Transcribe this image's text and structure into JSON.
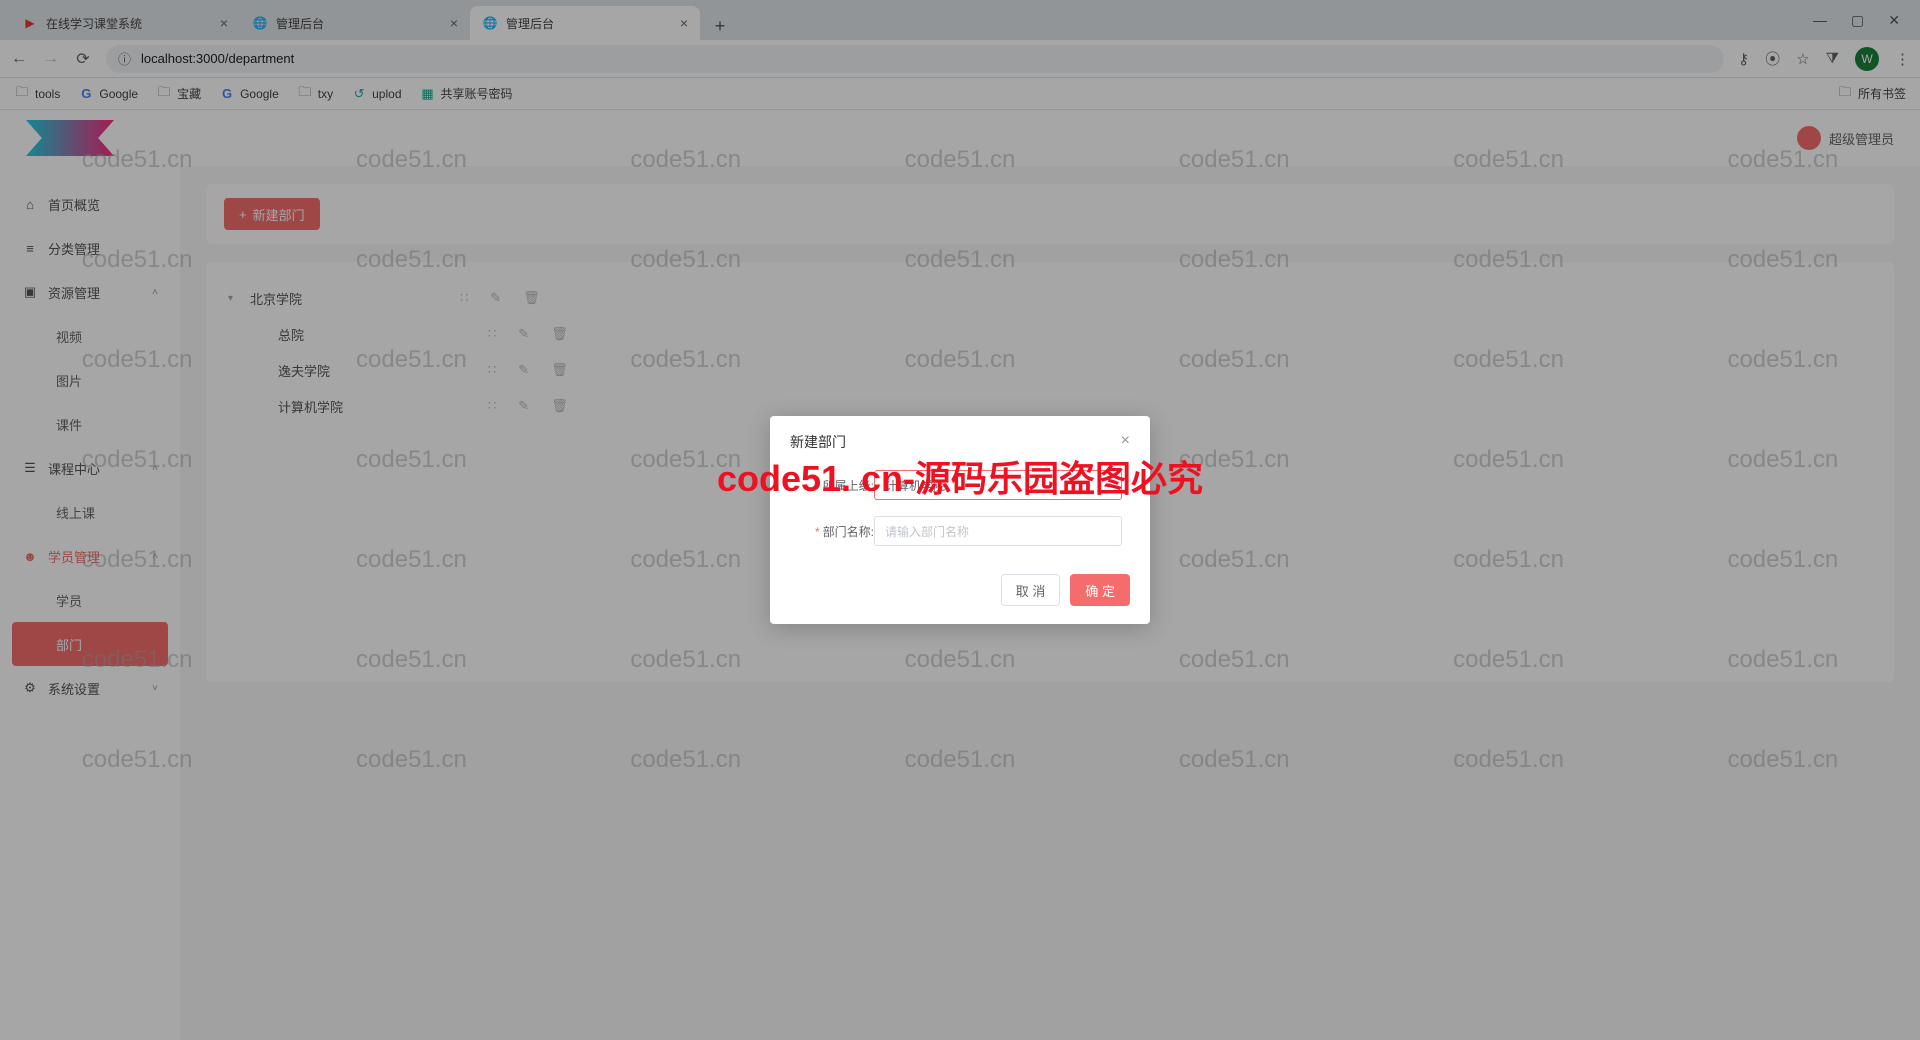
{
  "browser": {
    "tabs": [
      {
        "title": "在线学习课堂系统",
        "active": false
      },
      {
        "title": "管理后台",
        "active": false
      },
      {
        "title": "管理后台",
        "active": true
      }
    ],
    "url": "localhost:3000/department",
    "bookmarks": [
      "tools",
      "Google",
      "宝藏",
      "Google",
      "txy",
      "uplod",
      "共享账号密码"
    ],
    "all_bookmarks": "所有书签",
    "avatar_letter": "W"
  },
  "header": {
    "username": "超级管理员"
  },
  "sidebar": {
    "items": [
      {
        "label": "首页概览",
        "icon": "home"
      },
      {
        "label": "分类管理",
        "icon": "list"
      },
      {
        "label": "资源管理",
        "icon": "folder",
        "expand": true,
        "children": [
          "视频",
          "图片",
          "课件"
        ]
      },
      {
        "label": "课程中心",
        "icon": "chat",
        "expand": true,
        "children": [
          "线上课"
        ]
      },
      {
        "label": "学员管理",
        "icon": "user",
        "expand": true,
        "active": true,
        "children": [
          "学员",
          "部门"
        ],
        "active_child": "部门"
      },
      {
        "label": "系统设置",
        "icon": "gear",
        "expand": false
      }
    ]
  },
  "toolbar": {
    "new_label": "新建部门"
  },
  "tree": [
    {
      "label": "北京学院",
      "caret": true,
      "indent": false
    },
    {
      "label": "总院",
      "caret": false,
      "indent": true
    },
    {
      "label": "逸夫学院",
      "caret": false,
      "indent": true
    },
    {
      "label": "计算机学院",
      "caret": false,
      "indent": true
    }
  ],
  "dialog": {
    "title": "新建部门",
    "parent_label": "所属上级:",
    "parent_value": "计算机学院",
    "name_label": "部门名称:",
    "name_placeholder": "请输入部门名称",
    "cancel": "取 消",
    "confirm": "确 定"
  },
  "watermark": {
    "text": "code51.cn",
    "center": "code51. cn-源码乐园盗图必究"
  }
}
